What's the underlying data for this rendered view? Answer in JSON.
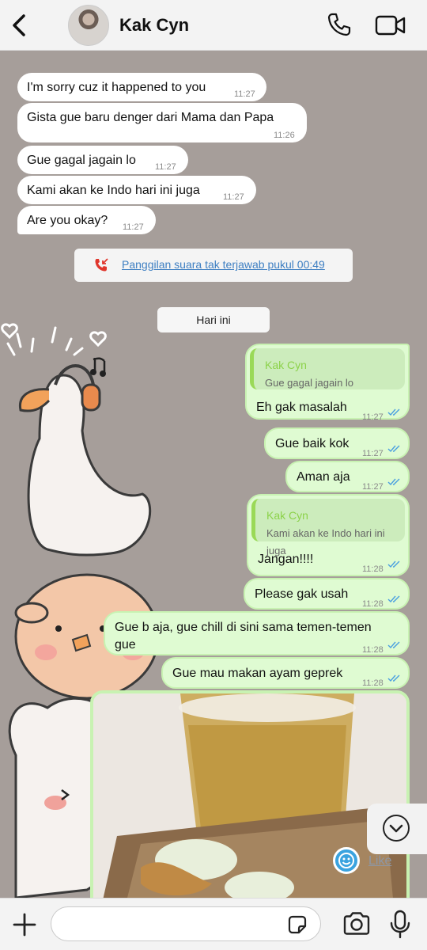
{
  "header": {
    "contact_name": "Kak Cyn"
  },
  "incoming": [
    {
      "text": "I'm sorry cuz it happened to you",
      "time": "11:27"
    },
    {
      "text": "Gista gue baru denger dari Mama dan Papa",
      "time": "11:26"
    },
    {
      "text": "Gue gagal jagain lo",
      "time": "11:27"
    },
    {
      "text": "Kami akan ke Indo hari ini juga",
      "time": "11:27"
    },
    {
      "text": "Are you okay?",
      "time": "11:27"
    }
  ],
  "missed_call": {
    "text": "Panggilan suara tak terjawab pukul 00:49"
  },
  "date_divider": "Hari ini",
  "outgoing": [
    {
      "quote_name": "Kak Cyn",
      "quote_text": "Gue gagal jagain lo",
      "text": "Eh gak masalah",
      "time": "11:27"
    },
    {
      "text": "Gue baik kok",
      "time": "11:27"
    },
    {
      "text": "Aman aja",
      "time": "11:27"
    },
    {
      "quote_name": "Kak Cyn",
      "quote_text": "Kami akan ke Indo hari ini juga",
      "text": "Jangan!!!!",
      "time": "11:28"
    },
    {
      "text": "Please gak usah",
      "time": "11:28"
    },
    {
      "text_line1": "Gue b aja, gue chill di sini sama temen-temen",
      "text_line2": "gue",
      "time": "11:28"
    },
    {
      "text": "Gue mau makan ayam geprek",
      "time": "11:28"
    }
  ],
  "photo_reaction_label": "Like",
  "composer": {
    "value": ""
  },
  "colors": {
    "outgoing_bubble": "#dffbd2",
    "quote_accent": "#9ad957",
    "read_ticks": "#4a9fe0",
    "missed_call_red": "#e0362c",
    "link_blue": "#3e7fc2"
  },
  "icons": [
    "back-arrow-icon",
    "phone-icon",
    "video-camera-icon",
    "missed-call-icon",
    "chevron-down-icon",
    "smiley-reaction-icon",
    "plus-icon",
    "sticker-icon",
    "camera-icon",
    "microphone-icon"
  ]
}
